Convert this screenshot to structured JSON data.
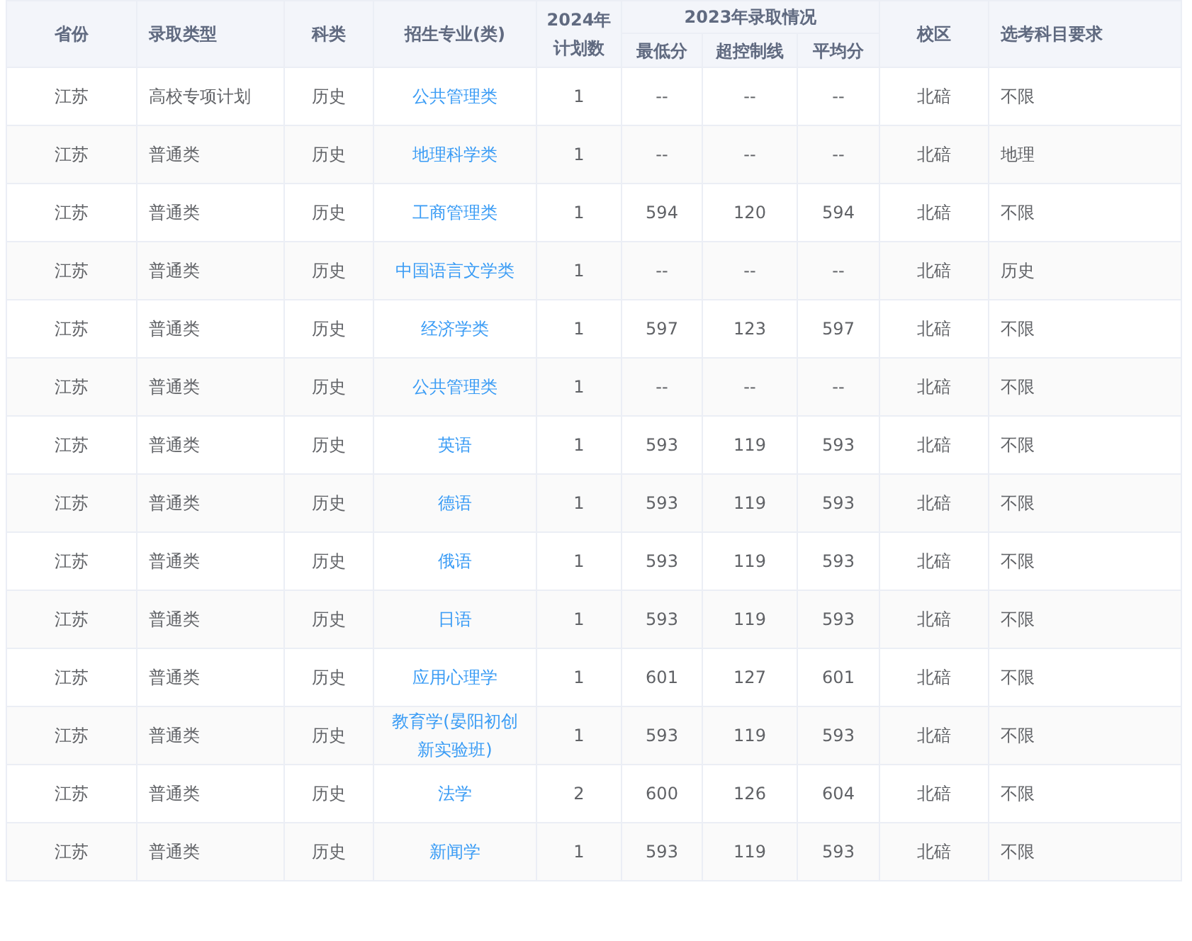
{
  "table": {
    "header": {
      "province": "省份",
      "admission_type": "录取类型",
      "subject": "科类",
      "major": "招生专业(类)",
      "plan_lines": [
        "2024年",
        "计划数"
      ],
      "group": "2023年录取情况",
      "min_score": "最低分",
      "over_line": "超控制线",
      "avg_score": "平均分",
      "campus": "校区",
      "requirement": "选考科目要求"
    },
    "rows": [
      {
        "province": "江苏",
        "admission_type": "高校专项计划",
        "subject": "历史",
        "major": "公共管理类",
        "plan": "1",
        "min_score": "--",
        "over_line": "--",
        "avg_score": "--",
        "campus": "北碚",
        "requirement": "不限"
      },
      {
        "province": "江苏",
        "admission_type": "普通类",
        "subject": "历史",
        "major": "地理科学类",
        "plan": "1",
        "min_score": "--",
        "over_line": "--",
        "avg_score": "--",
        "campus": "北碚",
        "requirement": "地理"
      },
      {
        "province": "江苏",
        "admission_type": "普通类",
        "subject": "历史",
        "major": "工商管理类",
        "plan": "1",
        "min_score": "594",
        "over_line": "120",
        "avg_score": "594",
        "campus": "北碚",
        "requirement": "不限"
      },
      {
        "province": "江苏",
        "admission_type": "普通类",
        "subject": "历史",
        "major": "中国语言文学类",
        "plan": "1",
        "min_score": "--",
        "over_line": "--",
        "avg_score": "--",
        "campus": "北碚",
        "requirement": "历史"
      },
      {
        "province": "江苏",
        "admission_type": "普通类",
        "subject": "历史",
        "major": "经济学类",
        "plan": "1",
        "min_score": "597",
        "over_line": "123",
        "avg_score": "597",
        "campus": "北碚",
        "requirement": "不限"
      },
      {
        "province": "江苏",
        "admission_type": "普通类",
        "subject": "历史",
        "major": "公共管理类",
        "plan": "1",
        "min_score": "--",
        "over_line": "--",
        "avg_score": "--",
        "campus": "北碚",
        "requirement": "不限"
      },
      {
        "province": "江苏",
        "admission_type": "普通类",
        "subject": "历史",
        "major": "英语",
        "plan": "1",
        "min_score": "593",
        "over_line": "119",
        "avg_score": "593",
        "campus": "北碚",
        "requirement": "不限"
      },
      {
        "province": "江苏",
        "admission_type": "普通类",
        "subject": "历史",
        "major": "德语",
        "plan": "1",
        "min_score": "593",
        "over_line": "119",
        "avg_score": "593",
        "campus": "北碚",
        "requirement": "不限"
      },
      {
        "province": "江苏",
        "admission_type": "普通类",
        "subject": "历史",
        "major": "俄语",
        "plan": "1",
        "min_score": "593",
        "over_line": "119",
        "avg_score": "593",
        "campus": "北碚",
        "requirement": "不限"
      },
      {
        "province": "江苏",
        "admission_type": "普通类",
        "subject": "历史",
        "major": "日语",
        "plan": "1",
        "min_score": "593",
        "over_line": "119",
        "avg_score": "593",
        "campus": "北碚",
        "requirement": "不限"
      },
      {
        "province": "江苏",
        "admission_type": "普通类",
        "subject": "历史",
        "major": "应用心理学",
        "plan": "1",
        "min_score": "601",
        "over_line": "127",
        "avg_score": "601",
        "campus": "北碚",
        "requirement": "不限"
      },
      {
        "province": "江苏",
        "admission_type": "普通类",
        "subject": "历史",
        "major": "教育学(晏阳初创新实验班)",
        "plan": "1",
        "min_score": "593",
        "over_line": "119",
        "avg_score": "593",
        "campus": "北碚",
        "requirement": "不限"
      },
      {
        "province": "江苏",
        "admission_type": "普通类",
        "subject": "历史",
        "major": "法学",
        "plan": "2",
        "min_score": "600",
        "over_line": "126",
        "avg_score": "604",
        "campus": "北碚",
        "requirement": "不限"
      },
      {
        "province": "江苏",
        "admission_type": "普通类",
        "subject": "历史",
        "major": "新闻学",
        "plan": "1",
        "min_score": "593",
        "over_line": "119",
        "avg_score": "593",
        "campus": "北碚",
        "requirement": "不限"
      }
    ]
  }
}
